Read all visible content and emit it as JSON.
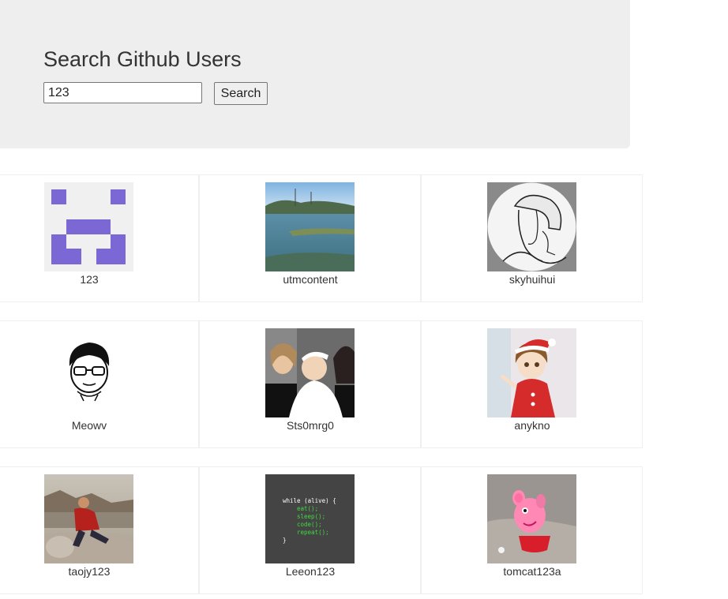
{
  "header": {
    "title": "Search Github Users",
    "search_value": "123",
    "search_button_label": "Search"
  },
  "users": [
    {
      "login": "123"
    },
    {
      "login": "utmcontent"
    },
    {
      "login": "skyhuihui"
    },
    {
      "login": "Meowv"
    },
    {
      "login": "Sts0mrg0"
    },
    {
      "login": "anykno"
    },
    {
      "login": "taojy123"
    },
    {
      "login": "Leeon123"
    },
    {
      "login": "tomcat123a"
    }
  ],
  "code_avatar": {
    "lines": [
      "while (alive) {",
      "eat();",
      "sleep();",
      "code();",
      "repeat();",
      "}"
    ]
  }
}
